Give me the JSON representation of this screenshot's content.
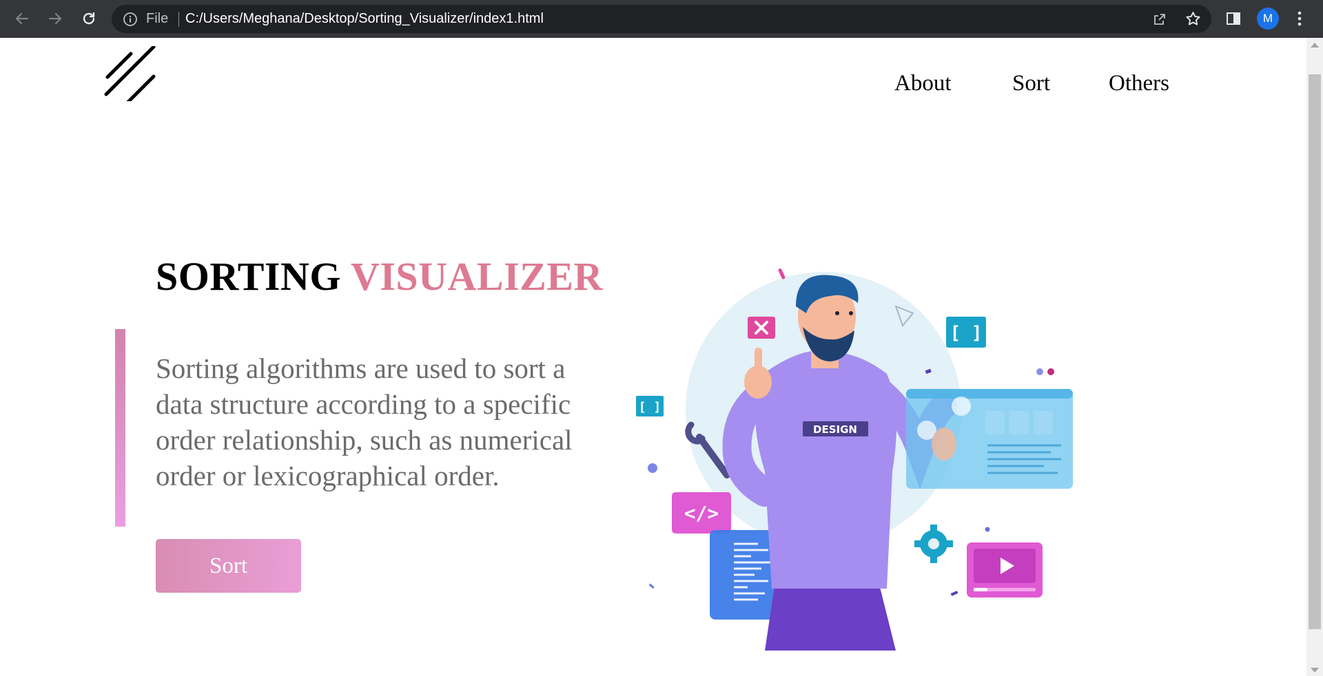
{
  "browser": {
    "scheme_label": "File",
    "url": "C:/Users/Meghana/Desktop/Sorting_Visualizer/index1.html",
    "profile_initial": "M"
  },
  "nav": {
    "links": [
      {
        "label": "About"
      },
      {
        "label": "Sort"
      },
      {
        "label": "Others"
      }
    ]
  },
  "hero": {
    "title_part1": "SORTING",
    "title_part2": "VISUALIZER",
    "description": "Sorting algorithms are used to sort a data structure according to a specific order relationship, such as numerical order or lexicographical order.",
    "button_label": "Sort",
    "illustration_label": "DESIGN"
  },
  "colors": {
    "accent": "#de7a92",
    "button_gradient_start": "#d98db2",
    "button_gradient_end": "#e99ed7",
    "chrome_bar": "#35363a",
    "omnibox": "#202124"
  },
  "icons": [
    "back-arrow-icon",
    "forward-arrow-icon",
    "reload-icon",
    "info-icon",
    "share-icon",
    "star-icon",
    "side-panel-icon",
    "kebab-menu-icon",
    "logo-icon"
  ]
}
